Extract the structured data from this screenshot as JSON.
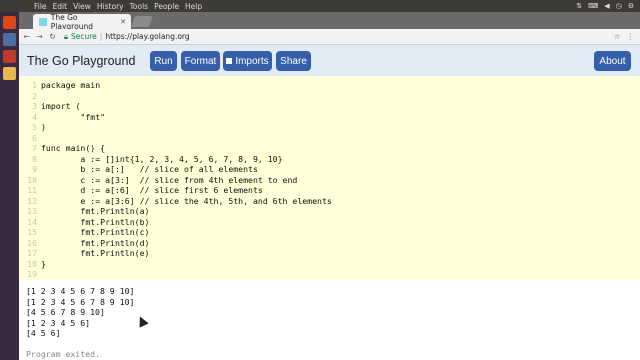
{
  "os": {
    "menu": [
      "File",
      "Edit",
      "View",
      "History",
      "Tools",
      "People",
      "Help"
    ],
    "right_icons": [
      "network-icon",
      "keyboard-icon",
      "volume-icon",
      "clock-icon",
      "gear-icon"
    ]
  },
  "browser": {
    "tab_title": "The Go Playground",
    "tab_close": "✕",
    "secure_label": "Secure",
    "url": "https://play.golang.org"
  },
  "playground": {
    "title": "The Go Playground",
    "buttons": {
      "run": "Run",
      "format": "Format",
      "imports": "Imports",
      "share": "Share",
      "about": "About"
    }
  },
  "editor": {
    "lines": [
      "package main",
      "",
      "import (",
      "        \"fmt\"",
      ")",
      "",
      "func main() {",
      "        a := []int{1, 2, 3, 4, 5, 6, 7, 8, 9, 10}",
      "        b := a[:]   // slice of all elements",
      "        c := a[3:]  // slice from 4th element to end",
      "        d := a[:6]  // slice first 6 elements",
      "        e := a[3:6] // slice the 4th, 5th, and 6th elements",
      "        fmt.Println(a)",
      "        fmt.Println(b)",
      "        fmt.Println(c)",
      "        fmt.Println(d)",
      "        fmt.Println(e)",
      "}",
      ""
    ]
  },
  "output": {
    "lines": [
      "[1 2 3 4 5 6 7 8 9 10]",
      "[1 2 3 4 5 6 7 8 9 10]",
      "[4 5 6 7 8 9 10]",
      "[1 2 3 4 5 6]",
      "[4 5 6]"
    ],
    "status": "Program exited."
  },
  "colors": {
    "header_bg": "#e0ebf5",
    "button_bg": "#375eab",
    "editor_bg": "#ffffd8"
  }
}
